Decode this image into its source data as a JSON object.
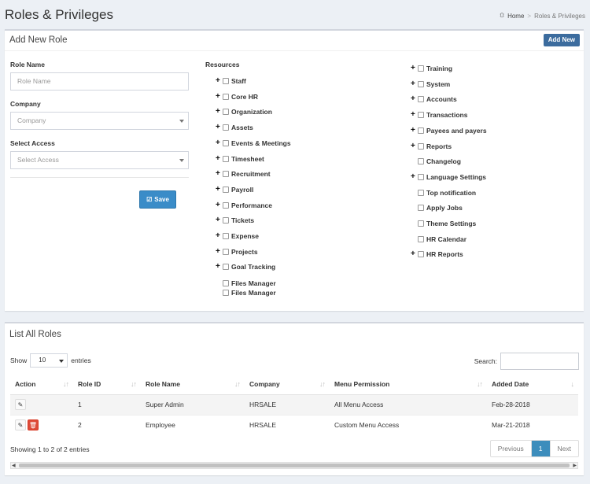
{
  "page": {
    "title": "Roles & Privileges"
  },
  "breadcrumb": {
    "home": "Home",
    "current": "Roles & Privileges"
  },
  "add_role": {
    "title": "Add New Role",
    "add_new_label": "Add New",
    "role_name_label": "Role Name",
    "role_name_placeholder": "Role Name",
    "company_label": "Company",
    "company_placeholder": "Company",
    "access_label": "Select Access",
    "access_placeholder": "Select Access",
    "save_label": "Save",
    "resources_label": "Resources",
    "resources_col1": [
      {
        "label": "Staff",
        "expand": true
      },
      {
        "label": "Core HR",
        "expand": true
      },
      {
        "label": "Organization",
        "expand": true
      },
      {
        "label": "Assets",
        "expand": true
      },
      {
        "label": "Events & Meetings",
        "expand": true
      },
      {
        "label": "Timesheet",
        "expand": true
      },
      {
        "label": "Recruitment",
        "expand": true
      },
      {
        "label": "Payroll",
        "expand": true
      },
      {
        "label": "Performance",
        "expand": true
      },
      {
        "label": "Tickets",
        "expand": true
      },
      {
        "label": "Expense",
        "expand": true
      },
      {
        "label": "Projects",
        "expand": true
      },
      {
        "label": "Goal Tracking",
        "expand": true
      }
    ],
    "resources_col1_extra": [
      "Files Manager",
      "Files Manager"
    ],
    "resources_col2": [
      {
        "label": "Training",
        "expand": true
      },
      {
        "label": "System",
        "expand": true
      },
      {
        "label": "Accounts",
        "expand": true
      },
      {
        "label": "Transactions",
        "expand": true
      },
      {
        "label": "Payees and payers",
        "expand": true
      },
      {
        "label": "Reports",
        "expand": true
      },
      {
        "label": "Changelog",
        "expand": false
      },
      {
        "label": "Language Settings",
        "expand": true
      },
      {
        "label": "Top notification",
        "expand": false
      },
      {
        "label": "Apply Jobs",
        "expand": false
      },
      {
        "label": "Theme Settings",
        "expand": false
      },
      {
        "label": "HR Calendar",
        "expand": false
      },
      {
        "label": "HR Reports",
        "expand": true
      }
    ]
  },
  "list": {
    "title": "List All Roles",
    "show_label": "Show",
    "entries_value": "10",
    "entries_label": "entries",
    "search_label": "Search:",
    "columns": [
      "Action",
      "Role ID",
      "Role Name",
      "Company",
      "Menu Permission",
      "Added Date"
    ],
    "rows": [
      {
        "id": "1",
        "name": "Super Admin",
        "company": "HRSALE",
        "permission": "All Menu Access",
        "date": "Feb-28-2018"
      },
      {
        "id": "2",
        "name": "Employee",
        "company": "HRSALE",
        "permission": "Custom Menu Access",
        "date": "Mar-21-2018"
      }
    ],
    "showing_text": "Showing 1 to 2 of 2 entries",
    "pager": {
      "previous": "Previous",
      "page": "1",
      "next": "Next"
    }
  }
}
